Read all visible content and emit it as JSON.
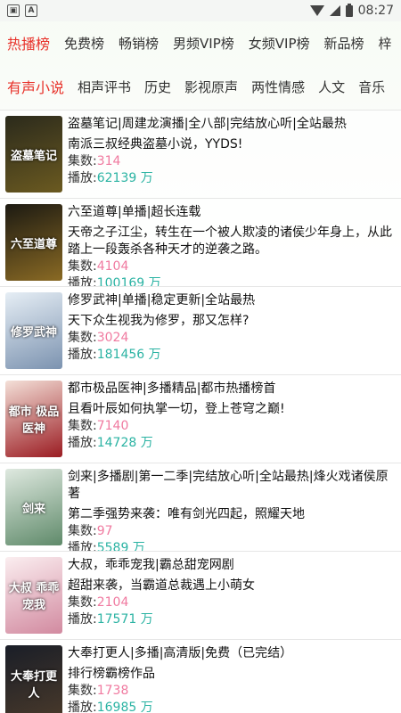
{
  "status": {
    "time": "08:27"
  },
  "rank_tabs": [
    {
      "label": "热播榜",
      "active": true
    },
    {
      "label": "免费榜"
    },
    {
      "label": "畅销榜"
    },
    {
      "label": "男频VIP榜"
    },
    {
      "label": "女频VIP榜"
    },
    {
      "label": "新品榜"
    },
    {
      "label": "梓"
    }
  ],
  "category_tabs": [
    {
      "label": "有声小说",
      "active": true
    },
    {
      "label": "相声评书"
    },
    {
      "label": "历史"
    },
    {
      "label": "影视原声"
    },
    {
      "label": "两性情感"
    },
    {
      "label": "人文"
    },
    {
      "label": "音乐"
    }
  ],
  "labels": {
    "count_prefix": "集数:",
    "play_prefix": "播放:",
    "wan": " 万"
  },
  "books": [
    {
      "cover_text": "盗墓笔记",
      "cover_colors": [
        "#2b2a1c",
        "#6b5a20"
      ],
      "title": "盗墓笔记|周建龙演播|全八部|完结放心听|全站最热",
      "desc": "南派三叔经典盗墓小说，YYDS!",
      "count": "314",
      "plays": "62139"
    },
    {
      "cover_text": "六至道尊",
      "cover_colors": [
        "#1c1a12",
        "#8a6a24"
      ],
      "title": "六至道尊|单播|超长连载",
      "desc": "天帝之子江尘，转生在一个被人欺凌的诸侯少年身上，从此踏上一段轰杀各种天才的逆袭之路。",
      "count": "4104",
      "plays": "100169"
    },
    {
      "cover_text": "修罗武神",
      "cover_colors": [
        "#e6eef5",
        "#7c93b0"
      ],
      "title": "修罗武神|单播|稳定更新|全站最热",
      "desc": "天下众生视我为修罗，那又怎样?",
      "count": "3024",
      "plays": "181456"
    },
    {
      "cover_text": "都市 极品医神",
      "cover_colors": [
        "#f4e0d8",
        "#9b1c22"
      ],
      "title": "都市极品医神|多播精品|都市热播榜首",
      "desc": "且看叶辰如何执掌一切，登上苍穹之巅!",
      "count": "7140",
      "plays": "14728"
    },
    {
      "cover_text": "剑来",
      "cover_colors": [
        "#dfe9e0",
        "#5f8a6a"
      ],
      "title": "剑来|多播剧|第一二季|完结放心听|全站最热|烽火戏诸侯原著",
      "desc": "第二季强势来袭：唯有剑光四起，照耀天地",
      "count": "97",
      "plays": "5589"
    },
    {
      "cover_text": "大叔 乖乖宠我",
      "cover_colors": [
        "#fbeef0",
        "#d28aa0"
      ],
      "title": "大叔，乖乖宠我|霸总甜宠网剧",
      "desc": "超甜来袭，当霸道总裁遇上小萌女",
      "count": "2104",
      "plays": "17571"
    },
    {
      "cover_text": "大奉打更人",
      "cover_colors": [
        "#1a1e28",
        "#4a3a2a"
      ],
      "title": "大奉打更人|多播|高清版|免费（已完结）",
      "desc": "排行榜霸榜作品",
      "count": "1738",
      "plays": "16985"
    }
  ]
}
